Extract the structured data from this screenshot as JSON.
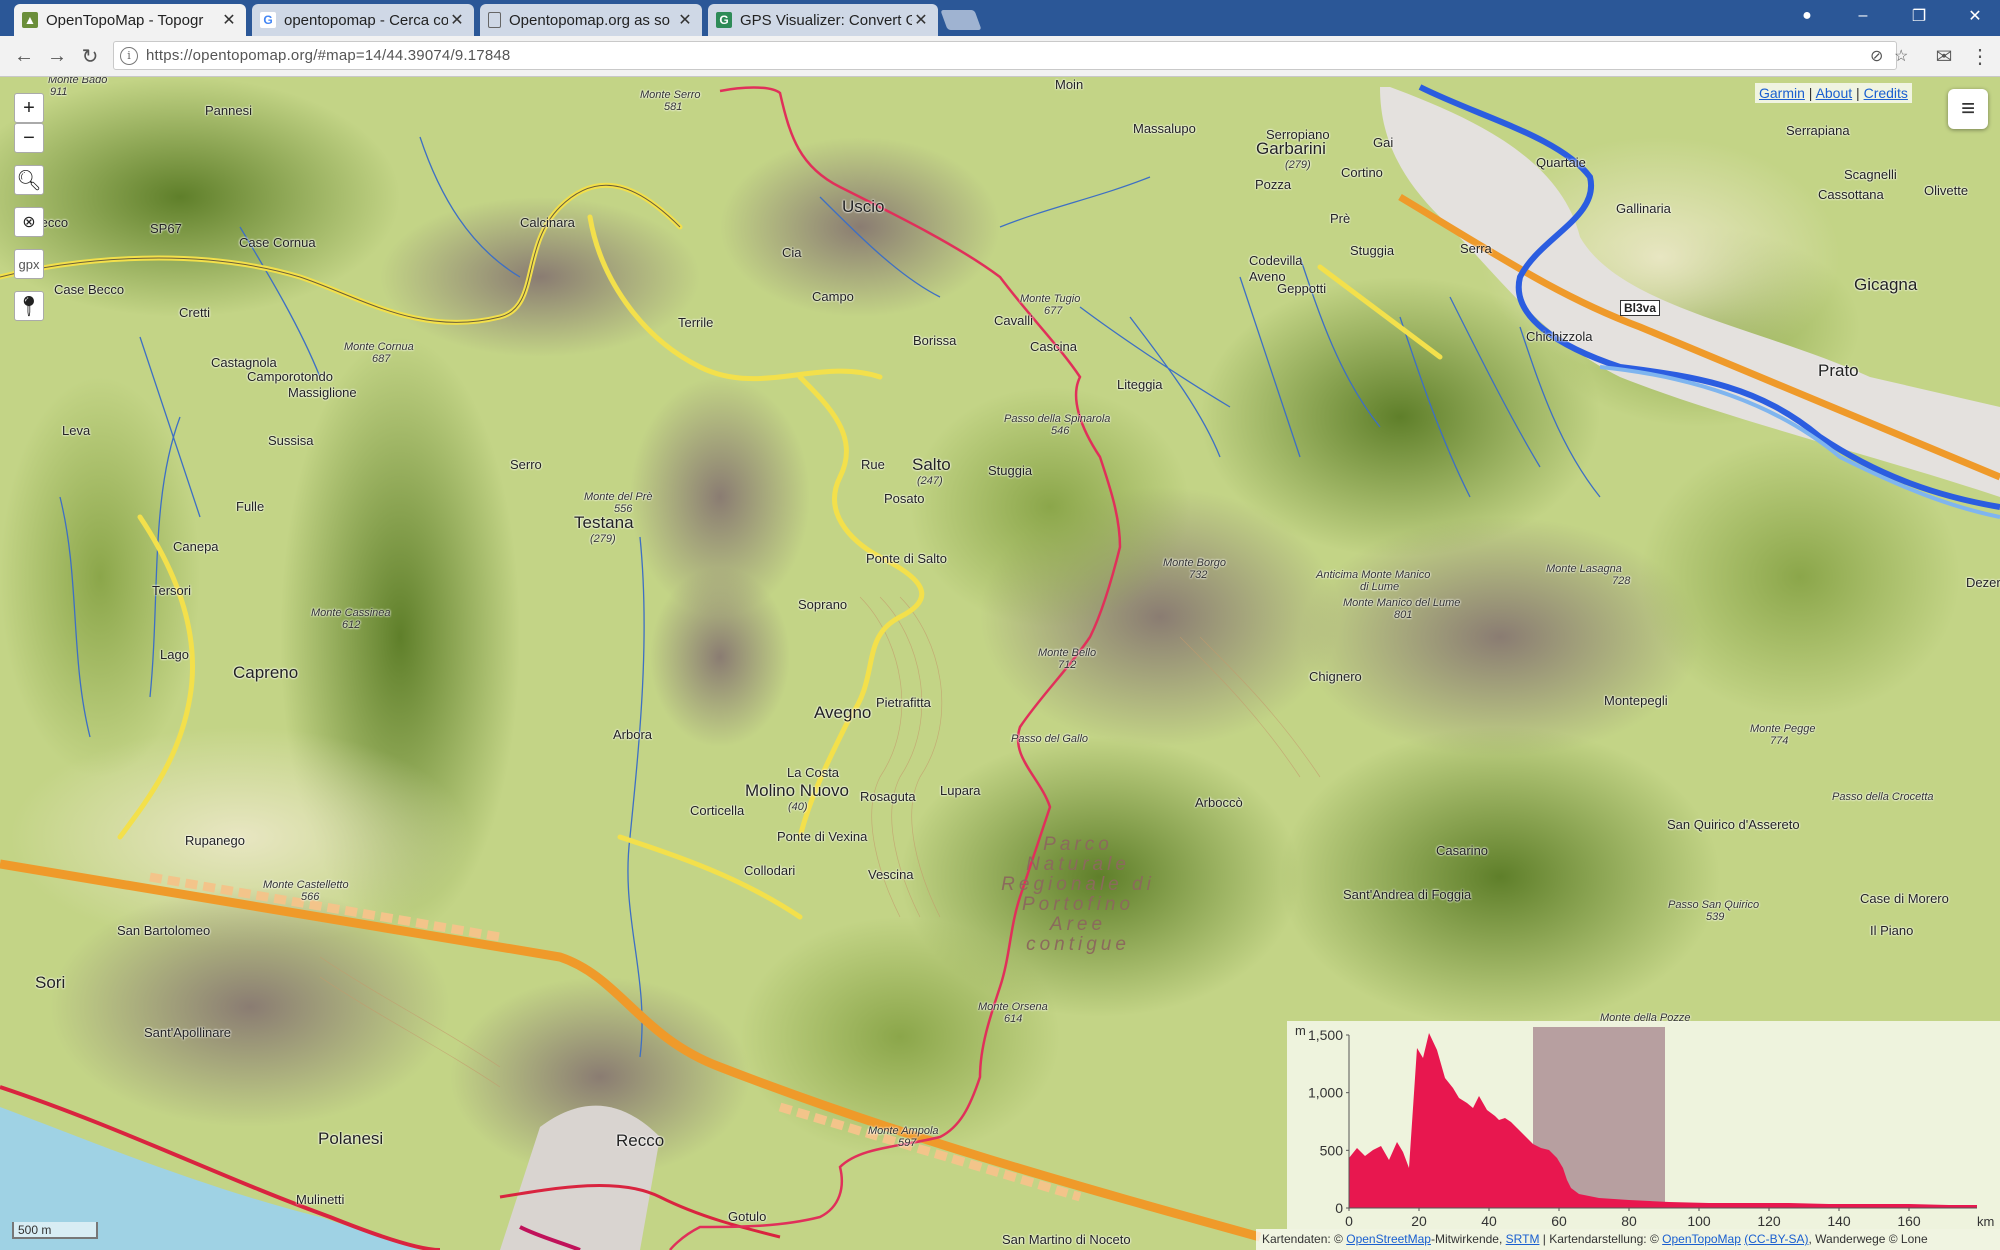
{
  "browser": {
    "tabs": [
      {
        "title": "OpenTopoMap - Topogr",
        "icon": "topo-favicon-icon",
        "active": true
      },
      {
        "title": "opentopomap - Cerca co",
        "icon": "google-favicon-icon",
        "active": false
      },
      {
        "title": "Opentopomap.org as so",
        "icon": "document-favicon-icon",
        "active": false
      },
      {
        "title": "GPS Visualizer: Convert G",
        "icon": "gpsvisualizer-favicon-icon",
        "active": false
      }
    ],
    "url": "https://opentopomap.org/#map=14/44.39074/9.17848"
  },
  "map_controls": {
    "zoom_in": "+",
    "zoom_out": "−",
    "gpx_label": "gpx"
  },
  "top_links": {
    "garmin": "Garmin",
    "sep": "|",
    "about": "About",
    "credits": "Credits"
  },
  "scale": {
    "label": "500 m"
  },
  "attribution": {
    "prefix": "Kartendaten: ©",
    "osm": "OpenStreetMap",
    "osm_suffix": "-Mitwirkende,",
    "srtm": "SRTM",
    "mid": "| Kartendarstellung: ©",
    "otm": "OpenTopoMap",
    "license": "(CC-BY-SA)",
    "tail": ", Wanderwege © Lone"
  },
  "elevation_chart": {
    "y_unit": "m",
    "x_unit": "km",
    "y_ticks": [
      "1,500",
      "1,000",
      "500",
      "0"
    ],
    "x_ticks": [
      "0",
      "20",
      "40",
      "60",
      "80",
      "100",
      "120",
      "140",
      "160"
    ],
    "colors": {
      "fill": "#e8174f",
      "highlight": "#8a5a6e"
    }
  },
  "place_labels": [
    {
      "t": "Monte Bado",
      "s": "small"
    },
    {
      "t": "911",
      "s": "small"
    },
    {
      "t": "Pannesi",
      "s": ""
    },
    {
      "t": "Monte Serro",
      "s": "small"
    },
    {
      "t": "581",
      "s": "small"
    },
    {
      "t": "Moin",
      "s": ""
    },
    {
      "t": "Massalupo",
      "s": ""
    },
    {
      "t": "Serropiano",
      "s": ""
    },
    {
      "t": "Garbarini",
      "s": "big"
    },
    {
      "t": "(279)",
      "s": "small"
    },
    {
      "t": "Gai",
      "s": ""
    },
    {
      "t": "Cortino",
      "s": ""
    },
    {
      "t": "Pozza",
      "s": ""
    },
    {
      "t": "Quartaie",
      "s": ""
    },
    {
      "t": "Serrapiana",
      "s": ""
    },
    {
      "t": "Scagnelli",
      "s": ""
    },
    {
      "t": "Olivette",
      "s": ""
    },
    {
      "t": "Gallinaria",
      "s": ""
    },
    {
      "t": "Cassottana",
      "s": ""
    },
    {
      "t": "Uscio",
      "s": "big"
    },
    {
      "t": "SP67",
      "s": ""
    },
    {
      "t": "Calcinara",
      "s": ""
    },
    {
      "t": "Case Cornua",
      "s": ""
    },
    {
      "t": "Case Becco",
      "s": ""
    },
    {
      "t": "Cretti",
      "s": ""
    },
    {
      "t": "Cia",
      "s": ""
    },
    {
      "t": "Campo",
      "s": ""
    },
    {
      "t": "Terrile",
      "s": ""
    },
    {
      "t": "Monte Tugio",
      "s": "small"
    },
    {
      "t": "677",
      "s": "small"
    },
    {
      "t": "Cavalli",
      "s": ""
    },
    {
      "t": "Cascina",
      "s": ""
    },
    {
      "t": "Borissa",
      "s": ""
    },
    {
      "t": "Codevilla",
      "s": ""
    },
    {
      "t": "Aveno",
      "s": ""
    },
    {
      "t": "Geppotti",
      "s": ""
    },
    {
      "t": "Stuggia",
      "s": ""
    },
    {
      "t": "Serra",
      "s": ""
    },
    {
      "t": "Prè",
      "s": ""
    },
    {
      "t": "Chichizzola",
      "s": ""
    },
    {
      "t": "Gicagna",
      "s": "big"
    },
    {
      "t": "Prato",
      "s": "big"
    },
    {
      "t": "Monte Cornua",
      "s": "small"
    },
    {
      "t": "687",
      "s": "small"
    },
    {
      "t": "Castagnola",
      "s": ""
    },
    {
      "t": "Camporotondo",
      "s": ""
    },
    {
      "t": "Massiglione",
      "s": ""
    },
    {
      "t": "Liteggia",
      "s": ""
    },
    {
      "t": "Passo della Spinarola",
      "s": "small"
    },
    {
      "t": "546",
      "s": "small"
    },
    {
      "t": "Leva",
      "s": ""
    },
    {
      "t": "Sussisa",
      "s": ""
    },
    {
      "t": "Serro",
      "s": ""
    },
    {
      "t": "Rue",
      "s": ""
    },
    {
      "t": "Salto",
      "s": "big"
    },
    {
      "t": "(247)",
      "s": "small"
    },
    {
      "t": "Stuggia",
      "s": ""
    },
    {
      "t": "Posato",
      "s": ""
    },
    {
      "t": "Monte del Prè",
      "s": "small"
    },
    {
      "t": "556",
      "s": "small"
    },
    {
      "t": "Testana",
      "s": "big"
    },
    {
      "t": "(279)",
      "s": "small"
    },
    {
      "t": "Fulle",
      "s": ""
    },
    {
      "t": "Canepa",
      "s": ""
    },
    {
      "t": "Tersori",
      "s": ""
    },
    {
      "t": "Ponte di Salto",
      "s": ""
    },
    {
      "t": "Monte Borgo",
      "s": "small"
    },
    {
      "t": "732",
      "s": "small"
    },
    {
      "t": "Anticima Monte Manico",
      "s": "small"
    },
    {
      "t": "di Lume",
      "s": "small"
    },
    {
      "t": "Monte Manico del Lume",
      "s": "small"
    },
    {
      "t": "801",
      "s": "small"
    },
    {
      "t": "Monte Lasagna",
      "s": "small"
    },
    {
      "t": "728",
      "s": "small"
    },
    {
      "t": "Dezere",
      "s": ""
    },
    {
      "t": "Monte Cassinea",
      "s": "small"
    },
    {
      "t": "612",
      "s": "small"
    },
    {
      "t": "Soprano",
      "s": ""
    },
    {
      "t": "Lago",
      "s": ""
    },
    {
      "t": "Capreno",
      "s": "big"
    },
    {
      "t": "Monte Bello",
      "s": "small"
    },
    {
      "t": "712",
      "s": "small"
    },
    {
      "t": "Chignero",
      "s": ""
    },
    {
      "t": "Pietrafitta",
      "s": ""
    },
    {
      "t": "Avegno",
      "s": "big"
    },
    {
      "t": "Montepegli",
      "s": ""
    },
    {
      "t": "Monte Pegge",
      "s": "small"
    },
    {
      "t": "774",
      "s": "small"
    },
    {
      "t": "Arbora",
      "s": ""
    },
    {
      "t": "Passo del Gallo",
      "s": "small"
    },
    {
      "t": "La Costa",
      "s": ""
    },
    {
      "t": "Molino Nuovo",
      "s": "big"
    },
    {
      "t": "(40)",
      "s": "small"
    },
    {
      "t": "Rosaguta",
      "s": ""
    },
    {
      "t": "Lupara",
      "s": ""
    },
    {
      "t": "Corticella",
      "s": ""
    },
    {
      "t": "Arboccò",
      "s": ""
    },
    {
      "t": "Passo della Crocetta",
      "s": "small"
    },
    {
      "t": "San Quirico d'Assereto",
      "s": ""
    },
    {
      "t": "Ponte di Vexina",
      "s": ""
    },
    {
      "t": "Rupanego",
      "s": ""
    },
    {
      "t": "Casarino",
      "s": ""
    },
    {
      "t": "Collodari",
      "s": ""
    },
    {
      "t": "Vescina",
      "s": ""
    },
    {
      "t": "Monte Castelletto",
      "s": "small"
    },
    {
      "t": "566",
      "s": "small"
    },
    {
      "t": "Sant'Andrea di Foggia",
      "s": ""
    },
    {
      "t": "Passo San Quirico",
      "s": "small"
    },
    {
      "t": "539",
      "s": "small"
    },
    {
      "t": "Case di Morero",
      "s": ""
    },
    {
      "t": "Il Piano",
      "s": ""
    },
    {
      "t": "San Bartolomeo",
      "s": ""
    },
    {
      "t": "Sori",
      "s": "big"
    },
    {
      "t": "Monte Orsena",
      "s": "small"
    },
    {
      "t": "614",
      "s": "small"
    },
    {
      "t": "Sant'Apollinare",
      "s": ""
    },
    {
      "t": "Monte della Pozze",
      "s": "small"
    },
    {
      "t": "Polanesi",
      "s": "big"
    },
    {
      "t": "Monte Ampola",
      "s": "small"
    },
    {
      "t": "597",
      "s": "small"
    },
    {
      "t": "Recco",
      "s": "big"
    },
    {
      "t": "Mulinetti",
      "s": ""
    },
    {
      "t": "Gotulo",
      "s": ""
    },
    {
      "t": "San Martino di Noceto",
      "s": ""
    },
    {
      "t": "Becco",
      "s": ""
    }
  ],
  "park_label": {
    "lines": [
      "Parco",
      "Naturale",
      "Regionale di",
      "Portofino",
      "Aree",
      "contigue"
    ]
  },
  "road_label": "Bl3va"
}
